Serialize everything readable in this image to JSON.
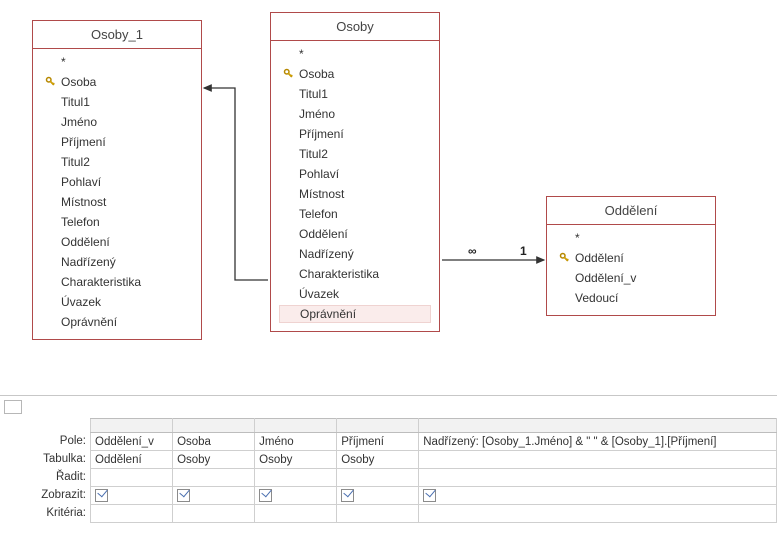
{
  "entities": {
    "osoby1": {
      "title": "Osoby_1",
      "fields": [
        "*",
        "Osoba",
        "Titul1",
        "Jméno",
        "Příjmení",
        "Titul2",
        "Pohlaví",
        "Místnost",
        "Telefon",
        "Oddělení",
        "Nadřízený",
        "Charakteristika",
        "Úvazek",
        "Oprávnění"
      ],
      "key_index": 1
    },
    "osoby": {
      "title": "Osoby",
      "fields": [
        "*",
        "Osoba",
        "Titul1",
        "Jméno",
        "Příjmení",
        "Titul2",
        "Pohlaví",
        "Místnost",
        "Telefon",
        "Oddělení",
        "Nadřízený",
        "Charakteristika",
        "Úvazek",
        "Oprávnění"
      ],
      "key_index": 1,
      "selected_index": 13
    },
    "oddeleni": {
      "title": "Oddělení",
      "fields": [
        "*",
        "Oddělení",
        "Oddělení_v",
        "Vedoucí"
      ],
      "key_index": 1
    }
  },
  "relations": {
    "inf": "∞",
    "one": "1"
  },
  "grid": {
    "labels": {
      "pole": "Pole:",
      "tabulka": "Tabulka:",
      "radit": "Řadit:",
      "zobrazit": "Zobrazit:",
      "kriteria": "Kritéria:"
    },
    "columns": [
      {
        "pole": "Oddělení_v",
        "tabulka": "Oddělení",
        "zobrazit": true
      },
      {
        "pole": "Osoba",
        "tabulka": "Osoby",
        "zobrazit": true
      },
      {
        "pole": "Jméno",
        "tabulka": "Osoby",
        "zobrazit": true
      },
      {
        "pole": "Příjmení",
        "tabulka": "Osoby",
        "zobrazit": true
      },
      {
        "pole": "Nadřízený: [Osoby_1.Jméno] & \" \" & [Osoby_1].[Příjmení]",
        "tabulka": "",
        "zobrazit": true,
        "wide": true
      }
    ]
  }
}
